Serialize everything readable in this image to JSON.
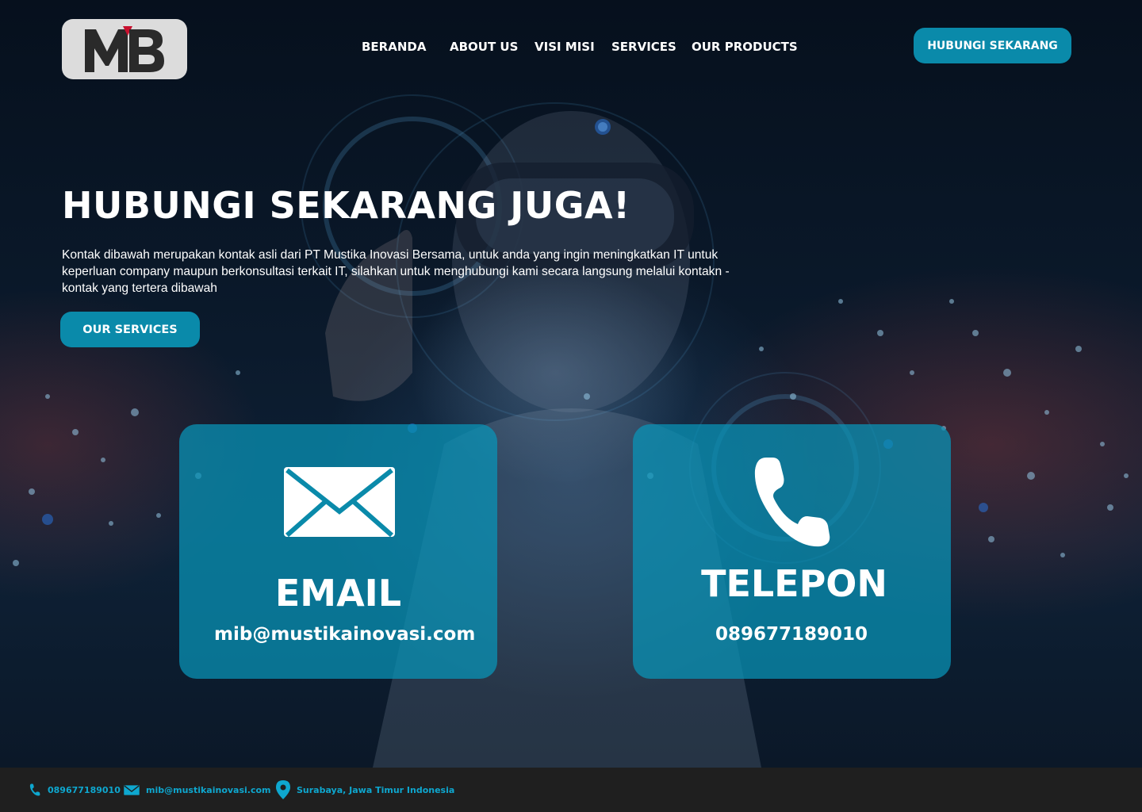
{
  "header": {
    "logo_text": "MB",
    "nav": [
      "BERANDA",
      "ABOUT US",
      "VISI MISI",
      "SERVICES",
      "OUR PRODUCTS"
    ],
    "cta_label": "HUBUNGI SEKARANG"
  },
  "hero": {
    "title": "HUBUNGI SEKARANG JUGA!",
    "description": "Kontak dibawah merupakan kontak asli dari PT Mustika Inovasi Bersama, untuk anda yang ingin meningkatkan IT untuk keperluan company maupun berkonsultasi terkait IT, silahkan untuk menghubungi kami secara langsung melalui kontakn - kontak yang tertera dibawah",
    "button_label": "OUR SERVICES"
  },
  "cards": {
    "email": {
      "icon": "envelope-icon",
      "title": "EMAIL",
      "value": "mib@mustikainovasi.com"
    },
    "phone": {
      "icon": "phone-icon",
      "title": "TELEPON",
      "value": "089677189010"
    }
  },
  "footer": {
    "phone": "089677189010",
    "email": "mib@mustikainovasi.com",
    "address": "Surabaya, Jawa Timur Indonesia"
  },
  "colors": {
    "accent": "#0a8aaa",
    "card": "#0896ba",
    "footer_bg": "#1f1f1f",
    "footer_text": "#0ea7cf",
    "logo_bg": "#dcdcdc",
    "logo_red": "#c8102e"
  }
}
